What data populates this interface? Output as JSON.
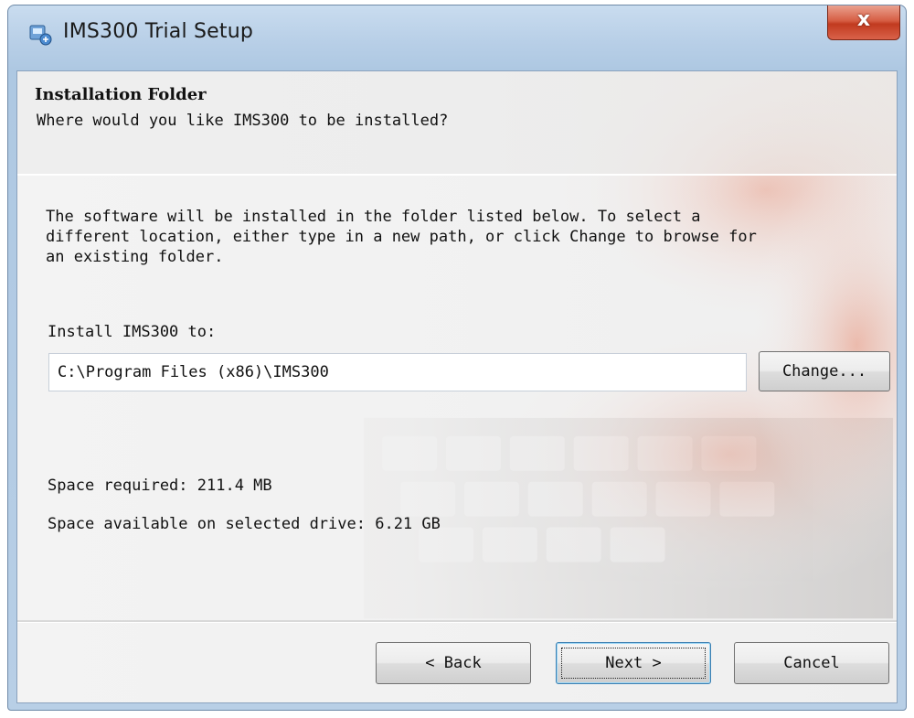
{
  "window": {
    "title": "IMS300 Trial Setup",
    "close_glyph": "x",
    "icon": "installer-icon"
  },
  "header": {
    "title": "Installation Folder",
    "subtitle": "Where would you like IMS300 to be installed?"
  },
  "body": {
    "description": "The software will be installed in the folder listed below. To select a\ndifferent location, either type in a new path, or click Change to browse for\nan existing folder.",
    "install_label": "Install IMS300 to:",
    "path_value": "C:\\Program Files (x86)\\IMS300",
    "change_button": "Change...",
    "space_required": "Space required: 211.4 MB",
    "space_available": "Space available on selected drive: 6.21 GB"
  },
  "footer": {
    "back_button": "< Back",
    "next_button": "Next >",
    "cancel_button": "Cancel"
  },
  "colors": {
    "title_bar": "#b8cfe7",
    "close_button": "#d65e44",
    "default_button_border": "#3c7fb1"
  }
}
